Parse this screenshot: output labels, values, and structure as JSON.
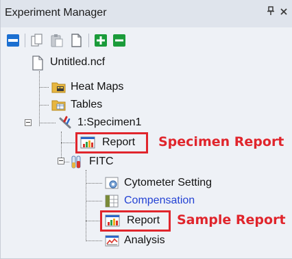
{
  "panel": {
    "title": "Experiment Manager",
    "pin_glyph": "ᴘ",
    "close_glyph": "×"
  },
  "toolbar": {
    "buttons": [
      {
        "icon": "window-icon"
      },
      {
        "icon": "copy-icon"
      },
      {
        "icon": "paste-icon"
      },
      {
        "icon": "document-icon"
      },
      {
        "icon": "expand-all-icon"
      },
      {
        "icon": "collapse-all-icon"
      }
    ]
  },
  "tree": {
    "root": {
      "label": "Untitled.ncf",
      "icon": "document-icon"
    },
    "heat_maps": {
      "label": "Heat Maps",
      "icon": "folder-icon"
    },
    "tables": {
      "label": "Tables",
      "icon": "folder-icon"
    },
    "specimen": {
      "label": "1:Specimen1",
      "icon": "specimen-icon"
    },
    "specimen_report": {
      "label": "Report",
      "icon": "report-icon"
    },
    "tube": {
      "label": "FITC",
      "icon": "tube-icon"
    },
    "cytometer_setting": {
      "label": "Cytometer Setting",
      "icon": "cytometer-setting-icon"
    },
    "compensation": {
      "label": "Compensation",
      "icon": "compensation-icon",
      "color": "#2342d4"
    },
    "sample_report": {
      "label": "Report",
      "icon": "report-icon"
    },
    "analysis": {
      "label": "Analysis",
      "icon": "analysis-icon"
    }
  },
  "annotations": {
    "specimen_report": "Specimen Report",
    "sample_report": "Sample Report"
  },
  "colors": {
    "annotation_red": "#e0252c",
    "toolbar_blue": "#1b6fd1",
    "toolbar_green": "#1a9b3a"
  }
}
